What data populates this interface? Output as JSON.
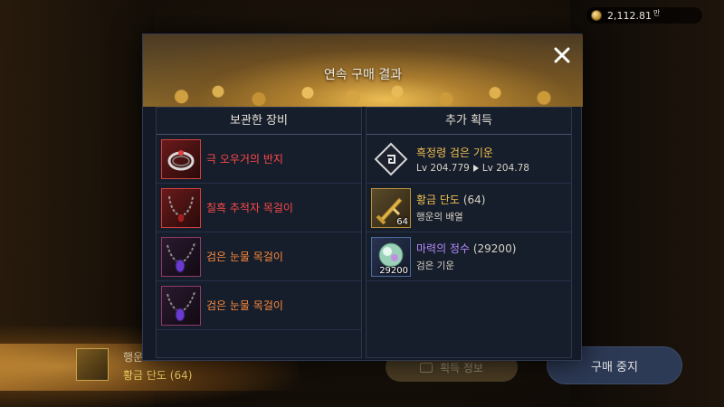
{
  "currency": {
    "amount": "2,112.81",
    "unit": "만",
    "icon": "coin-icon"
  },
  "background": {
    "item_line1": "행운",
    "item_line2": "황금 단도 (64)",
    "achievement_button": "획득 정보"
  },
  "stop_button": "구매 중지",
  "modal": {
    "title": "연속 구매 결과",
    "close_icon": "close-icon",
    "left_panel": {
      "title": "보관한 장비",
      "items": [
        {
          "name": "극 오우거의 반지",
          "icon": "ring-icon",
          "color": "#ff4a4a"
        },
        {
          "name": "칠흑 추적자 목걸이",
          "icon": "necklace-icon",
          "color": "#ff4a4a"
        },
        {
          "name": "검은 눈물 목걸이",
          "icon": "purple-gem-necklace-icon",
          "color": "#ff8a3a"
        },
        {
          "name": "검은 눈물 목걸이",
          "icon": "purple-gem-necklace-icon",
          "color": "#ff8a3a"
        }
      ]
    },
    "right_panel": {
      "title": "추가 획득",
      "items": [
        {
          "name": "흑정령 검은 기운",
          "quantity": "",
          "sub": "Lv 204.779",
          "sub2": "Lv 204.78",
          "icon": "black-spirit-icon",
          "color": "#f0c050"
        },
        {
          "name": "황금 단도",
          "quantity": "(64)",
          "badge": "64",
          "sub": "행운의 배열",
          "icon": "golden-dagger-icon",
          "color": "#f0c050"
        },
        {
          "name": "마력의 정수",
          "quantity": "(29200)",
          "badge": "29200",
          "sub": "검은 기운",
          "icon": "mana-essence-icon",
          "color": "#b68cff"
        }
      ]
    }
  }
}
